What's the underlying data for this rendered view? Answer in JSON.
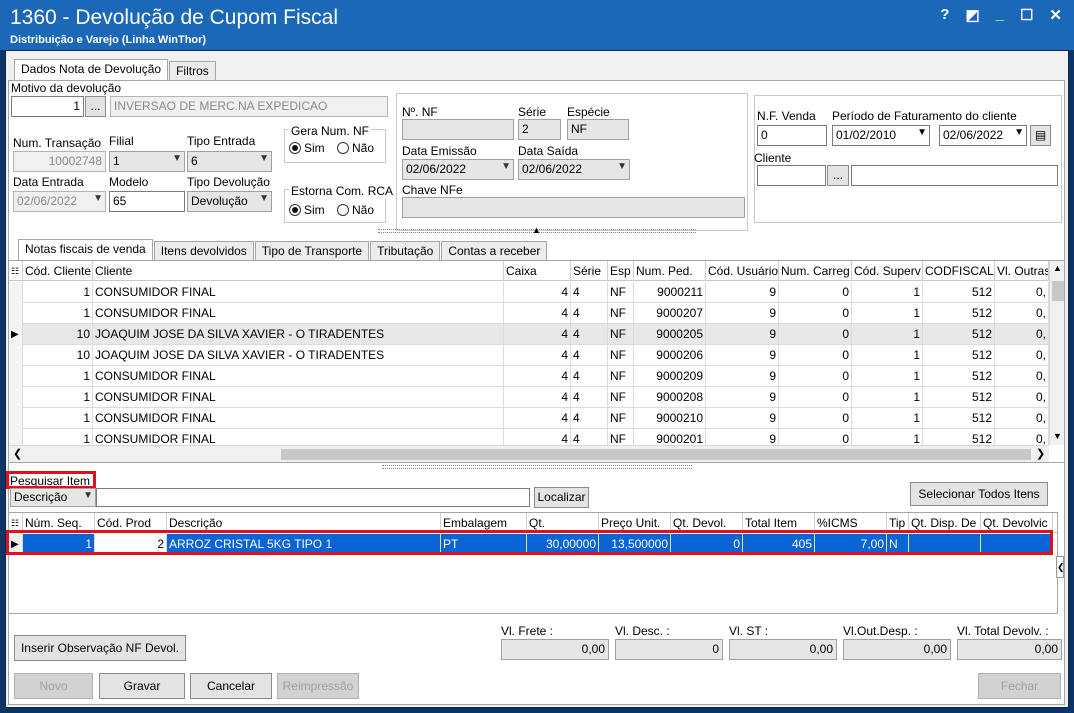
{
  "window": {
    "title": "1360 - Devolução de Cupom Fiscal",
    "subtitle": "Distribuição e Varejo (Linha WinThor)",
    "controls": [
      "?",
      "◩",
      "_",
      "☐",
      "✕"
    ]
  },
  "top_tabs": [
    "Dados Nota de Devolução",
    "Filtros"
  ],
  "motivo": {
    "label": "Motivo da devolução",
    "code": "1",
    "browse": "...",
    "desc": "INVERSAO DE MERC.NA EXPEDICAO"
  },
  "left": {
    "num_transacao_label": "Num. Transação",
    "num_transacao": "10002748",
    "filial_label": "Filial",
    "filial": "1",
    "tipo_entrada_label": "Tipo Entrada",
    "tipo_entrada": "6",
    "data_entrada_label": "Data Entrada",
    "data_entrada": "02/06/2022",
    "modelo_label": "Modelo",
    "modelo": "65",
    "tipo_devolucao_label": "Tipo Devolução",
    "tipo_devolucao": "Devolução"
  },
  "gera_num_nf": {
    "label": "Gera Num. NF",
    "sim": "Sim",
    "nao": "Não",
    "selected": "Sim"
  },
  "estorna_rca": {
    "label": "Estorna Com. RCA",
    "sim": "Sim",
    "nao": "Não",
    "selected": "Sim"
  },
  "nf": {
    "num_label": "Nº. NF",
    "num": "",
    "serie_label": "Série",
    "serie": "2",
    "especie_label": "Espécie",
    "especie": "NF",
    "data_emissao_label": "Data Emissão",
    "data_emissao": "02/06/2022",
    "data_saida_label": "Data Saída",
    "data_saida": "02/06/2022",
    "chave_label": "Chave NFe",
    "chave": ""
  },
  "right": {
    "nf_venda_label": "N.F. Venda",
    "nf_venda": "0",
    "periodo_label": "Período de Faturamento do cliente",
    "periodo_ini": "01/02/2010",
    "periodo_fim": "02/06/2022",
    "cliente_label": "Cliente",
    "cliente_code": "",
    "browse": "...",
    "cliente_nome": ""
  },
  "mid_tabs": [
    "Notas fiscais de venda",
    "Itens devolvidos",
    "Tipo de Transporte",
    "Tributação",
    "Contas a receber"
  ],
  "sales_grid": {
    "columns": [
      "Cód. Cliente",
      "Cliente",
      "Caixa",
      "Série",
      "Esp",
      "Num. Ped.",
      "Cód. Usuário",
      "Num. Carreg",
      "Cód. Superv",
      "CODFISCAL",
      "Vl. Outras"
    ],
    "rows": [
      [
        "1",
        "CONSUMIDOR FINAL",
        "4",
        "4",
        "NF",
        "9000211",
        "9",
        "0",
        "1",
        "512",
        "0,"
      ],
      [
        "1",
        "CONSUMIDOR FINAL",
        "4",
        "4",
        "NF",
        "9000207",
        "9",
        "0",
        "1",
        "512",
        "0,"
      ],
      [
        "10",
        "JOAQUIM JOSE DA SILVA XAVIER - O TIRADENTES",
        "4",
        "4",
        "NF",
        "9000205",
        "9",
        "0",
        "1",
        "512",
        "0,"
      ],
      [
        "10",
        "JOAQUIM JOSE DA SILVA XAVIER - O TIRADENTES",
        "4",
        "4",
        "NF",
        "9000206",
        "9",
        "0",
        "1",
        "512",
        "0,"
      ],
      [
        "1",
        "CONSUMIDOR FINAL",
        "4",
        "4",
        "NF",
        "9000209",
        "9",
        "0",
        "1",
        "512",
        "0,"
      ],
      [
        "1",
        "CONSUMIDOR FINAL",
        "4",
        "4",
        "NF",
        "9000208",
        "9",
        "0",
        "1",
        "512",
        "0,"
      ],
      [
        "1",
        "CONSUMIDOR FINAL",
        "4",
        "4",
        "NF",
        "9000210",
        "9",
        "0",
        "1",
        "512",
        "0,"
      ],
      [
        "1",
        "CONSUMIDOR FINAL",
        "4",
        "4",
        "NF",
        "9000201",
        "9",
        "0",
        "1",
        "512",
        "0,"
      ]
    ],
    "current_row": 2
  },
  "search": {
    "label": "Pesquisar Item",
    "field": "Descrição",
    "query": "",
    "localizar": "Localizar",
    "select_all": "Selecionar Todos Itens"
  },
  "items_grid": {
    "columns": [
      "Núm. Seq.",
      "Cód. Prod",
      "Descrição",
      "Embalagem",
      "Qt.",
      "Preço Unit.",
      "Qt. Devol.",
      "Total Item",
      "%ICMS",
      "Tip",
      "Qt. Disp. De",
      "Qt. Devolvic"
    ],
    "rows": [
      [
        "1",
        "2",
        "ARROZ CRISTAL 5KG TIPO 1",
        "PT",
        "30,00000",
        "13,500000",
        "0",
        "405",
        "7,00",
        "N",
        "",
        ""
      ]
    ]
  },
  "totals": {
    "frete_label": "Vl. Frete :",
    "frete": "0,00",
    "desc_label": "Vl. Desc. :",
    "desc": "0",
    "st_label": "Vl. ST :",
    "st": "0,00",
    "outdesp_label": "Vl.Out.Desp. :",
    "outdesp": "0,00",
    "total_label": "Vl. Total Devolv. :",
    "total": "0,00"
  },
  "buttons": {
    "inserir_obs": "Inserir Observação NF Devol.",
    "novo": "Novo",
    "gravar": "Gravar",
    "cancelar": "Cancelar",
    "reimpressao": "Reimpressão",
    "fechar": "Fechar"
  },
  "colors": {
    "title_bar": "#1b68b8",
    "selection": "#0a64d6",
    "highlight": "#e01020"
  }
}
